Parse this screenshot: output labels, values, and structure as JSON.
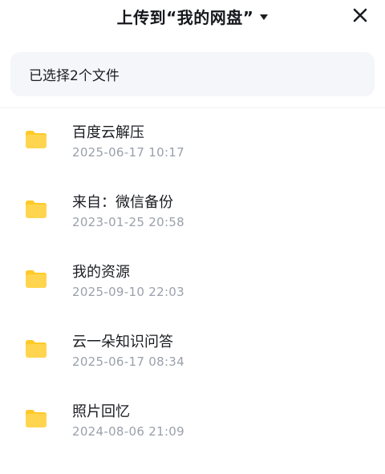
{
  "header": {
    "title": "上传到“我的网盘”",
    "caret_icon": "caret-down-icon",
    "close_icon": "close-icon"
  },
  "banner": {
    "text": "已选择2个文件"
  },
  "colors": {
    "folder": "#ffd54f",
    "folder_tab": "#ffca28",
    "meta_text": "#9aa0ab",
    "banner_bg": "#f5f6fa"
  },
  "folders": [
    {
      "name": "百度云解压",
      "date": "2025-06-17",
      "time": "10:17",
      "icon": "folder-icon"
    },
    {
      "name": "来自：微信备份",
      "date": "2023-01-25",
      "time": "20:58",
      "icon": "folder-icon"
    },
    {
      "name": "我的资源",
      "date": "2025-09-10",
      "time": "22:03",
      "icon": "folder-icon"
    },
    {
      "name": "云一朵知识问答",
      "date": "2025-06-17",
      "time": "08:34",
      "icon": "folder-icon"
    },
    {
      "name": "照片回忆",
      "date": "2024-08-06",
      "time": "21:09",
      "icon": "folder-icon"
    }
  ]
}
